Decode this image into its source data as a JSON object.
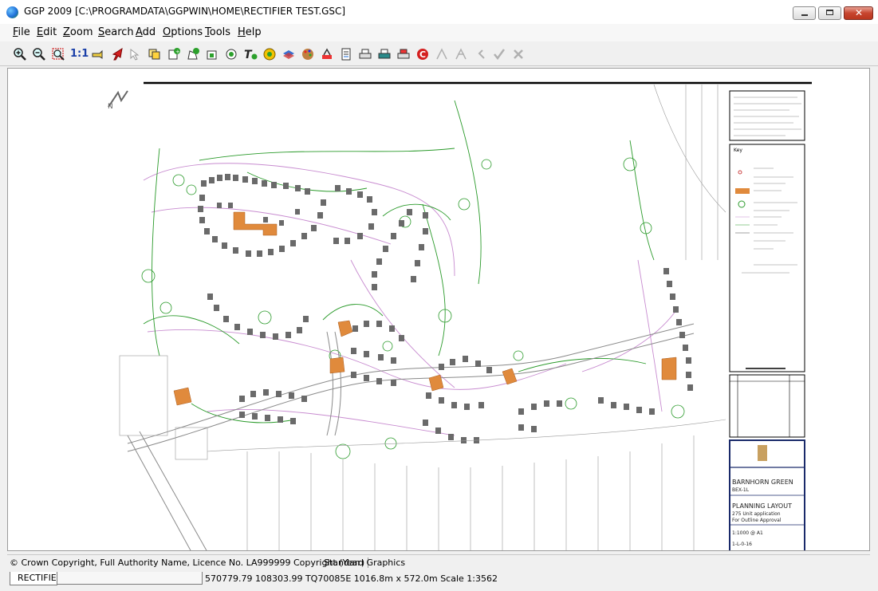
{
  "window": {
    "title": "GGP 2009 [C:\\PROGRAMDATA\\GGPWIN\\HOME\\RECTIFIER TEST.GSC]",
    "app_icon": "globe-icon",
    "controls": [
      "minimize-icon",
      "maximize-icon",
      "close-icon"
    ],
    "close_color": "#c7452f"
  },
  "menubar": {
    "items": [
      {
        "first": "F",
        "rest": "ile"
      },
      {
        "first": "E",
        "rest": "dit"
      },
      {
        "first": "Z",
        "rest": "oom"
      },
      {
        "first": "S",
        "rest": "earch"
      },
      {
        "first": "A",
        "rest": "dd"
      },
      {
        "first": "O",
        "rest": "ptions"
      },
      {
        "first": "T",
        "rest": "ools"
      },
      {
        "first": "H",
        "rest": "elp"
      }
    ]
  },
  "toolbar": {
    "scale_label": "1:1",
    "icons": [
      "zoom-in-icon",
      "zoom-out-icon",
      "zoom-window-icon",
      "one-to-one-label",
      "pan-hand-icon",
      "pointer-arrow-icon",
      "select-objects-icon",
      "copy-layers-icon",
      "add-point-icon",
      "add-polygon-icon",
      "add-area-icon",
      "add-circle-icon",
      "add-text-icon",
      "add-symbol-icon",
      "layers-icon",
      "palette-icon",
      "properties-icon",
      "document-icon",
      "print-icon",
      "printer-setup-icon",
      "plot-icon",
      "refresh-icon",
      "edit-vertex-icon",
      "move-vertex-icon",
      "undo-icon",
      "accept-icon",
      "cancel-icon"
    ]
  },
  "map": {
    "orange_fill": "#e08a3c",
    "green_line": "#2a9a2a",
    "pink_line": "#c88cd0",
    "building_gray": "#6a6a6a",
    "north_arrow_label": "N",
    "title_block": {
      "site_name": "BARNHORN GREEN",
      "ref": "BEX-1L",
      "drawing_title": "PLANNING LAYOUT",
      "drawing_subtitle": "275 Unit application",
      "note": "For Outline Approval",
      "scale_value": "1:1000 @ A1",
      "drawing_no": "1-L-0-16"
    },
    "key_title": "Key"
  },
  "status": {
    "copyright": "© Crown Copyright, Full Authority Name, Licence No. LA999999 Copyright (Year)",
    "graphics_mode": "Standard Graphics",
    "tab_label": "RECTIFIE",
    "coordinates": "570779.79 108303.99 TQ70085E 1016.8m x 572.0m Scale 1:3562"
  }
}
